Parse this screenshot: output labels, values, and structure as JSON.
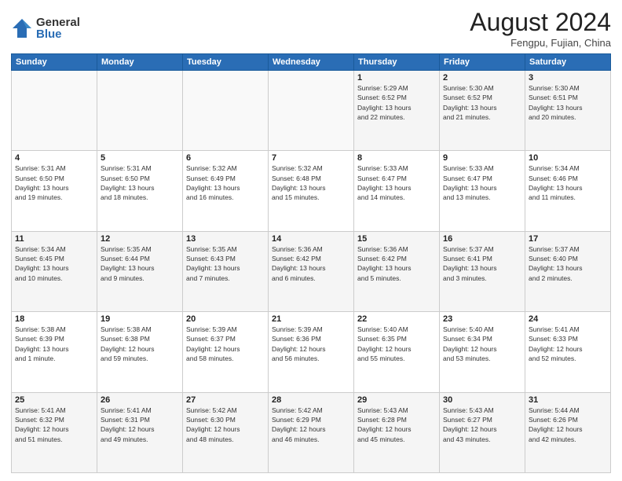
{
  "header": {
    "logo_general": "General",
    "logo_blue": "Blue",
    "title": "August 2024",
    "location": "Fengpu, Fujian, China"
  },
  "weekdays": [
    "Sunday",
    "Monday",
    "Tuesday",
    "Wednesday",
    "Thursday",
    "Friday",
    "Saturday"
  ],
  "weeks": [
    [
      {
        "day": "",
        "info": ""
      },
      {
        "day": "",
        "info": ""
      },
      {
        "day": "",
        "info": ""
      },
      {
        "day": "",
        "info": ""
      },
      {
        "day": "1",
        "info": "Sunrise: 5:29 AM\nSunset: 6:52 PM\nDaylight: 13 hours\nand 22 minutes."
      },
      {
        "day": "2",
        "info": "Sunrise: 5:30 AM\nSunset: 6:52 PM\nDaylight: 13 hours\nand 21 minutes."
      },
      {
        "day": "3",
        "info": "Sunrise: 5:30 AM\nSunset: 6:51 PM\nDaylight: 13 hours\nand 20 minutes."
      }
    ],
    [
      {
        "day": "4",
        "info": "Sunrise: 5:31 AM\nSunset: 6:50 PM\nDaylight: 13 hours\nand 19 minutes."
      },
      {
        "day": "5",
        "info": "Sunrise: 5:31 AM\nSunset: 6:50 PM\nDaylight: 13 hours\nand 18 minutes."
      },
      {
        "day": "6",
        "info": "Sunrise: 5:32 AM\nSunset: 6:49 PM\nDaylight: 13 hours\nand 16 minutes."
      },
      {
        "day": "7",
        "info": "Sunrise: 5:32 AM\nSunset: 6:48 PM\nDaylight: 13 hours\nand 15 minutes."
      },
      {
        "day": "8",
        "info": "Sunrise: 5:33 AM\nSunset: 6:47 PM\nDaylight: 13 hours\nand 14 minutes."
      },
      {
        "day": "9",
        "info": "Sunrise: 5:33 AM\nSunset: 6:47 PM\nDaylight: 13 hours\nand 13 minutes."
      },
      {
        "day": "10",
        "info": "Sunrise: 5:34 AM\nSunset: 6:46 PM\nDaylight: 13 hours\nand 11 minutes."
      }
    ],
    [
      {
        "day": "11",
        "info": "Sunrise: 5:34 AM\nSunset: 6:45 PM\nDaylight: 13 hours\nand 10 minutes."
      },
      {
        "day": "12",
        "info": "Sunrise: 5:35 AM\nSunset: 6:44 PM\nDaylight: 13 hours\nand 9 minutes."
      },
      {
        "day": "13",
        "info": "Sunrise: 5:35 AM\nSunset: 6:43 PM\nDaylight: 13 hours\nand 7 minutes."
      },
      {
        "day": "14",
        "info": "Sunrise: 5:36 AM\nSunset: 6:42 PM\nDaylight: 13 hours\nand 6 minutes."
      },
      {
        "day": "15",
        "info": "Sunrise: 5:36 AM\nSunset: 6:42 PM\nDaylight: 13 hours\nand 5 minutes."
      },
      {
        "day": "16",
        "info": "Sunrise: 5:37 AM\nSunset: 6:41 PM\nDaylight: 13 hours\nand 3 minutes."
      },
      {
        "day": "17",
        "info": "Sunrise: 5:37 AM\nSunset: 6:40 PM\nDaylight: 13 hours\nand 2 minutes."
      }
    ],
    [
      {
        "day": "18",
        "info": "Sunrise: 5:38 AM\nSunset: 6:39 PM\nDaylight: 13 hours\nand 1 minute."
      },
      {
        "day": "19",
        "info": "Sunrise: 5:38 AM\nSunset: 6:38 PM\nDaylight: 12 hours\nand 59 minutes."
      },
      {
        "day": "20",
        "info": "Sunrise: 5:39 AM\nSunset: 6:37 PM\nDaylight: 12 hours\nand 58 minutes."
      },
      {
        "day": "21",
        "info": "Sunrise: 5:39 AM\nSunset: 6:36 PM\nDaylight: 12 hours\nand 56 minutes."
      },
      {
        "day": "22",
        "info": "Sunrise: 5:40 AM\nSunset: 6:35 PM\nDaylight: 12 hours\nand 55 minutes."
      },
      {
        "day": "23",
        "info": "Sunrise: 5:40 AM\nSunset: 6:34 PM\nDaylight: 12 hours\nand 53 minutes."
      },
      {
        "day": "24",
        "info": "Sunrise: 5:41 AM\nSunset: 6:33 PM\nDaylight: 12 hours\nand 52 minutes."
      }
    ],
    [
      {
        "day": "25",
        "info": "Sunrise: 5:41 AM\nSunset: 6:32 PM\nDaylight: 12 hours\nand 51 minutes."
      },
      {
        "day": "26",
        "info": "Sunrise: 5:41 AM\nSunset: 6:31 PM\nDaylight: 12 hours\nand 49 minutes."
      },
      {
        "day": "27",
        "info": "Sunrise: 5:42 AM\nSunset: 6:30 PM\nDaylight: 12 hours\nand 48 minutes."
      },
      {
        "day": "28",
        "info": "Sunrise: 5:42 AM\nSunset: 6:29 PM\nDaylight: 12 hours\nand 46 minutes."
      },
      {
        "day": "29",
        "info": "Sunrise: 5:43 AM\nSunset: 6:28 PM\nDaylight: 12 hours\nand 45 minutes."
      },
      {
        "day": "30",
        "info": "Sunrise: 5:43 AM\nSunset: 6:27 PM\nDaylight: 12 hours\nand 43 minutes."
      },
      {
        "day": "31",
        "info": "Sunrise: 5:44 AM\nSunset: 6:26 PM\nDaylight: 12 hours\nand 42 minutes."
      }
    ]
  ]
}
